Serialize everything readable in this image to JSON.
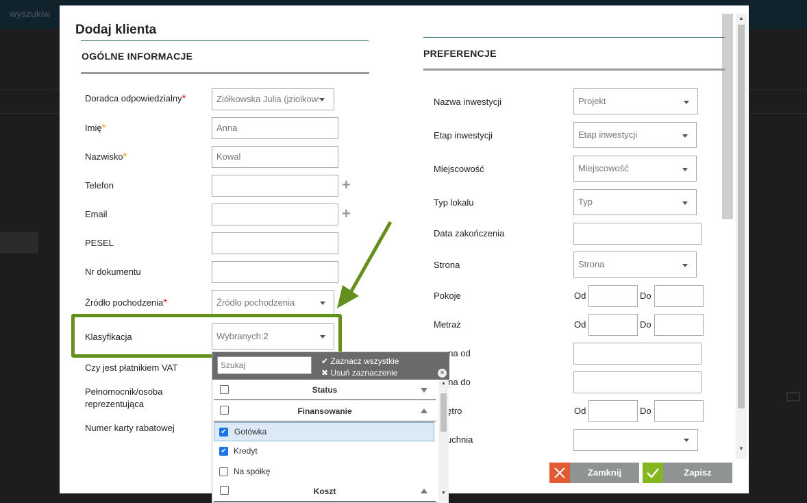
{
  "background": {
    "topbar_text": "wyszukiw"
  },
  "modal": {
    "title": "Dodaj klienta"
  },
  "general": {
    "title": "OGÓLNE INFORMACJE",
    "advisor_label": "Doradca odpowiedzialny",
    "advisor_value": "Ziółkowska Julia (jziolkowska)",
    "first_name_label": "Imię",
    "first_name_value": "Anna",
    "last_name_label": "Nazwisko",
    "last_name_value": "Kowal",
    "phone_label": "Telefon",
    "email_label": "Email",
    "pesel_label": "PESEL",
    "doc_label": "Nr dokumentu",
    "source_label": "Źródło pochodzenia",
    "source_placeholder": "Źródło pochodzenia",
    "class_label": "Klasyfikacja",
    "class_value": "Wybranych:2",
    "vat_label": "Czy jest płatnikiem VAT",
    "proxy_label": "Pełnomocnik/osoba reprezentująca",
    "card_label": "Numer karty rabatowej",
    "required_mark": "*"
  },
  "dropdown": {
    "search_placeholder": "Szukaj",
    "select_all": "Zaznacz wszystkie",
    "clear_selection": "Usuń zaznaczenie",
    "groups": [
      {
        "label": "Status"
      },
      {
        "label": "Finansowanie"
      },
      {
        "label": "Koszt"
      }
    ],
    "options": [
      {
        "label": "Gotówka",
        "checked": true
      },
      {
        "label": "Kredyt",
        "checked": true
      },
      {
        "label": "Na spółkę",
        "checked": false
      }
    ]
  },
  "preferences": {
    "title": "PREFERENCJE",
    "investment_label": "Nazwa inwestycji",
    "investment_value": "Projekt",
    "stage_label": "Etap inwestycji",
    "stage_value": "Etap inwestycji",
    "city_label": "Miejscowość",
    "city_value": "Miejscowość",
    "type_label": "Typ lokalu",
    "type_value": "Typ",
    "end_date_label": "Data zakończenia",
    "side_label": "Strona",
    "side_value": "Strona",
    "rooms_label": "Pokoje",
    "area_label": "Metraż",
    "price_from_label": "ena od",
    "price_to_label": "ena do",
    "floor_label": "ętro",
    "kitchen_label": "uchnia",
    "from": "Od",
    "to": "Do"
  },
  "buttons": {
    "close": "Zamknij",
    "save": "Zapisz"
  },
  "colors": {
    "accent_green": "#63901d",
    "teal_line": "#2d6a73",
    "close_icon": "#e05a33",
    "save_icon": "#84b81f"
  }
}
